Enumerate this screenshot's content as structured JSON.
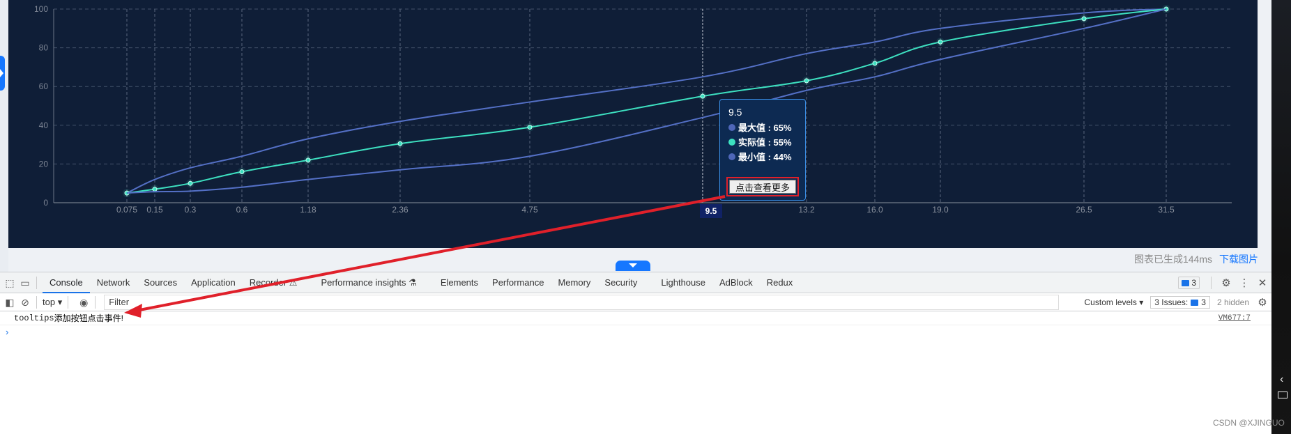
{
  "chart_data": {
    "type": "line",
    "title": "",
    "xlabel": "",
    "ylabel": "",
    "x": [
      "0.075",
      "0.15",
      "0.3",
      "0.6",
      "1.18",
      "2.36",
      "4.75",
      "9.5",
      "13.2",
      "16.0",
      "19.0",
      "26.5",
      "31.5"
    ],
    "ylim": [
      0,
      100
    ],
    "yticks": [
      0,
      20,
      40,
      60,
      80,
      100
    ],
    "grid": true,
    "series": [
      {
        "name": "最大值",
        "color": "#5470c6",
        "values": [
          5,
          12,
          18,
          24,
          33,
          42,
          52,
          65,
          77,
          83,
          90,
          98,
          100
        ]
      },
      {
        "name": "实际值",
        "color": "#3de0c0",
        "values": [
          5,
          7,
          10,
          16,
          22,
          30.5,
          39,
          55,
          63,
          72,
          83,
          95,
          100
        ]
      },
      {
        "name": "最小值",
        "color": "#5470c6",
        "values": [
          5,
          5.7,
          6,
          8,
          12,
          17,
          24,
          44,
          58,
          65,
          74,
          90,
          100
        ]
      }
    ],
    "active_x": "9.5"
  },
  "tooltip": {
    "title": "9.5",
    "rows": [
      {
        "label": "最大值 : 65%",
        "color": "#4e66b8"
      },
      {
        "label": "实际值 : 55%",
        "color": "#3de0c0"
      },
      {
        "label": "最小值 : 44%",
        "color": "#4e66b8"
      }
    ],
    "button_label": "点击查看更多"
  },
  "footer": {
    "status": "图表已生成144ms",
    "download": "下载图片"
  },
  "devtools": {
    "tabs": [
      "Console",
      "Network",
      "Sources",
      "Application",
      "Recorder ⚠",
      "Performance insights ⚗",
      "Elements",
      "Performance",
      "Memory",
      "Security",
      "Lighthouse",
      "AdBlock",
      "Redux"
    ],
    "active_tab": "Console",
    "messages_badge": "3",
    "context": "top",
    "filter_placeholder": "Filter",
    "levels": "Custom levels",
    "issues_label": "3 Issues:",
    "issues_count": "3",
    "hidden": "2 hidden",
    "console": {
      "message_prefix": "tooltips",
      "message_text": "添加按钮点击事件!",
      "source": "VM677:7",
      "prompt": "›"
    }
  },
  "watermark": "CSDN @XJINGUO"
}
